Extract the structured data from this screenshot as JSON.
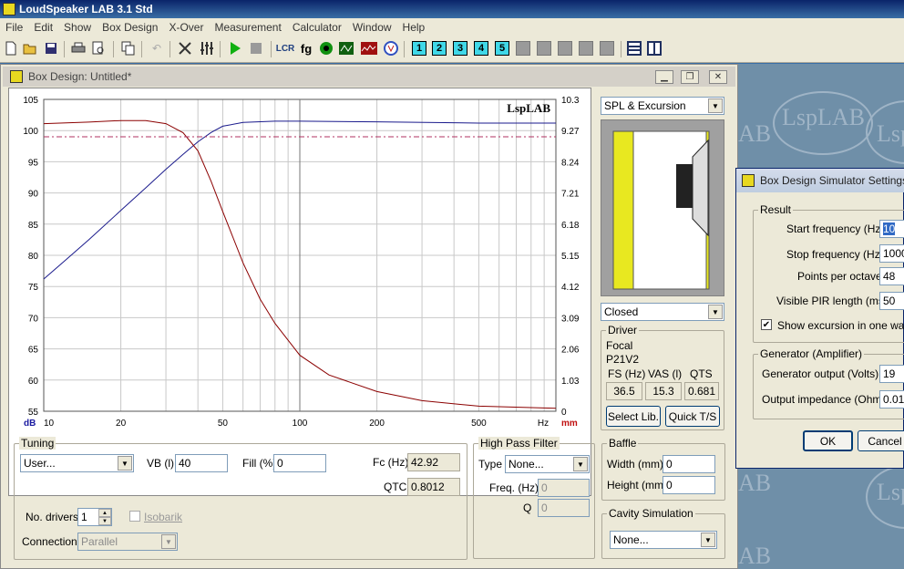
{
  "app": {
    "title": "LoudSpeaker LAB 3.1 Std"
  },
  "menu": [
    "File",
    "Edit",
    "Show",
    "Box Design",
    "X-Over",
    "Measurement",
    "Calculator",
    "Window",
    "Help"
  ],
  "toolbar": {
    "layout_numbers": [
      "1",
      "2",
      "3",
      "4",
      "5"
    ],
    "lcr_label": "LCR",
    "fg_label": "fg"
  },
  "window": {
    "title": "Box Design: Untitled*"
  },
  "chart_data": {
    "type": "line",
    "watermark": "LspLAB",
    "x_scale": "log",
    "xlim": [
      10,
      1000
    ],
    "x_ticks": [
      "10",
      "20",
      "50",
      "100",
      "200",
      "500"
    ],
    "x_unit": "Hz",
    "ylim_left": [
      55,
      105
    ],
    "y_ticks_left": [
      "105",
      "100",
      "95",
      "90",
      "85",
      "80",
      "75",
      "70",
      "65",
      "60",
      "55"
    ],
    "y_unit_left": "dB",
    "ylim_right": [
      0,
      10.3
    ],
    "y_ticks_right": [
      "10.3",
      "9.27",
      "8.24",
      "7.21",
      "6.18",
      "5.15",
      "4.12",
      "3.09",
      "2.06",
      "1.03",
      "0"
    ],
    "y_unit_right": "mm",
    "series": [
      {
        "color": "#1a1a8c",
        "axis": "left",
        "points": [
          [
            10,
            76.2
          ],
          [
            12,
            79
          ],
          [
            15,
            82.5
          ],
          [
            20,
            87.2
          ],
          [
            25,
            90.8
          ],
          [
            30,
            93.8
          ],
          [
            35,
            96.2
          ],
          [
            40,
            98.2
          ],
          [
            45,
            99.7
          ],
          [
            50,
            100.7
          ],
          [
            60,
            101.3
          ],
          [
            80,
            101.5
          ],
          [
            100,
            101.5
          ],
          [
            200,
            101.4
          ],
          [
            500,
            101.2
          ],
          [
            1000,
            101.2
          ]
        ]
      },
      {
        "color": "#8b0000",
        "axis": "right",
        "points": [
          [
            10,
            9.5
          ],
          [
            15,
            9.55
          ],
          [
            20,
            9.6
          ],
          [
            25,
            9.6
          ],
          [
            30,
            9.5
          ],
          [
            35,
            9.2
          ],
          [
            40,
            8.6
          ],
          [
            45,
            7.6
          ],
          [
            50,
            6.6
          ],
          [
            60,
            4.9
          ],
          [
            70,
            3.7
          ],
          [
            80,
            2.9
          ],
          [
            100,
            1.85
          ],
          [
            130,
            1.2
          ],
          [
            200,
            0.65
          ],
          [
            300,
            0.35
          ],
          [
            500,
            0.17
          ],
          [
            1000,
            0.1
          ]
        ]
      },
      {
        "color": "#b03060",
        "axis": "left",
        "style": "dashdot",
        "points": [
          [
            10,
            99
          ],
          [
            1000,
            99
          ]
        ]
      }
    ],
    "cursor_x": 100
  },
  "side": {
    "view_mode": "SPL & Excursion",
    "box_type": "Closed"
  },
  "driver": {
    "group_label": "Driver",
    "brand": "Focal",
    "model": "P21V2",
    "fs_label": "FS (Hz)",
    "vas_label": "VAS (l)",
    "qts_label": "QTS",
    "fs": "36.5",
    "vas": "15.3",
    "qts": "0.681",
    "select_lib": "Select Lib.",
    "quick_ts": "Quick T/S"
  },
  "tuning": {
    "group_label": "Tuning",
    "alignment": "User...",
    "vb_label": "VB (l)",
    "vb": "40",
    "fill_label": "Fill (%)",
    "fill": "0",
    "fc_label": "Fc (Hz)",
    "fc": "42.92",
    "qtc_label": "QTC",
    "qtc": "0.8012",
    "drivers_label": "No. drivers",
    "drivers": "1",
    "isobarik_label": "Isobarik",
    "connection_label": "Connection",
    "connection": "Parallel"
  },
  "hpf": {
    "group_label": "High Pass Filter",
    "type_label": "Type",
    "type": "None...",
    "freq_label": "Freq. (Hz)",
    "freq": "0",
    "q_label": "Q",
    "q": "0"
  },
  "baffle": {
    "group_label": "Baffle",
    "width_label": "Width (mm)",
    "width": "0",
    "height_label": "Height (mm)",
    "height": "0"
  },
  "cavity": {
    "group_label": "Cavity Simulation",
    "value": "None..."
  },
  "dialog": {
    "title": "Box Design Simulator Settings",
    "result_label": "Result",
    "start_label": "Start frequency (Hz)",
    "start": "10",
    "stop_label": "Stop frequency (Hz)",
    "stop": "1000",
    "ppo_label": "Points per octave",
    "ppo": "48",
    "pir_label": "Visible PIR length (ms)",
    "pir": "50",
    "excursion_label": "Show excursion in one way R",
    "generator_label": "Generator (Amplifier)",
    "gen_out_label": "Generator output (Volts)",
    "gen_out": "19",
    "out_imp_label": "Output impedance (Ohms)",
    "out_imp": "0.01",
    "ok": "OK",
    "cancel": "Cancel"
  },
  "desktop": {
    "watermark": "LspLAB",
    "watermark_short": "AB"
  }
}
